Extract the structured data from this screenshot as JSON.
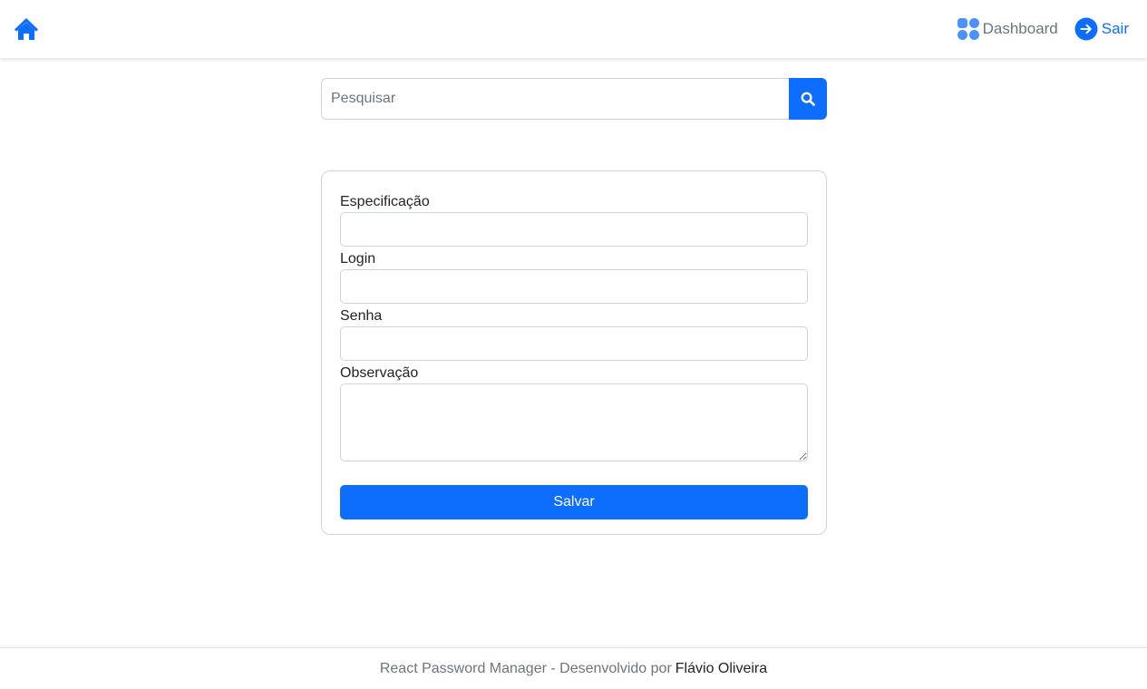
{
  "navbar": {
    "home_icon": "house-icon",
    "dashboard": {
      "label": "Dashboard",
      "icon": "grid-icon"
    },
    "logout": {
      "label": "Sair",
      "icon": "arrow-right-circle-icon"
    }
  },
  "search": {
    "placeholder": "Pesquisar",
    "value": "",
    "button_icon": "search-icon"
  },
  "form": {
    "fields": [
      {
        "label": "Especificação",
        "value": ""
      },
      {
        "label": "Login",
        "value": ""
      },
      {
        "label": "Senha",
        "value": ""
      },
      {
        "label": "Observação",
        "value": ""
      }
    ],
    "submit_label": "Salvar"
  },
  "footer": {
    "text": "React Password Manager - Desenvolvido por",
    "author": "Flávio Oliveira"
  },
  "colors": {
    "primary": "#0d6efd",
    "muted": "#6c757d",
    "border": "#ced4da"
  }
}
